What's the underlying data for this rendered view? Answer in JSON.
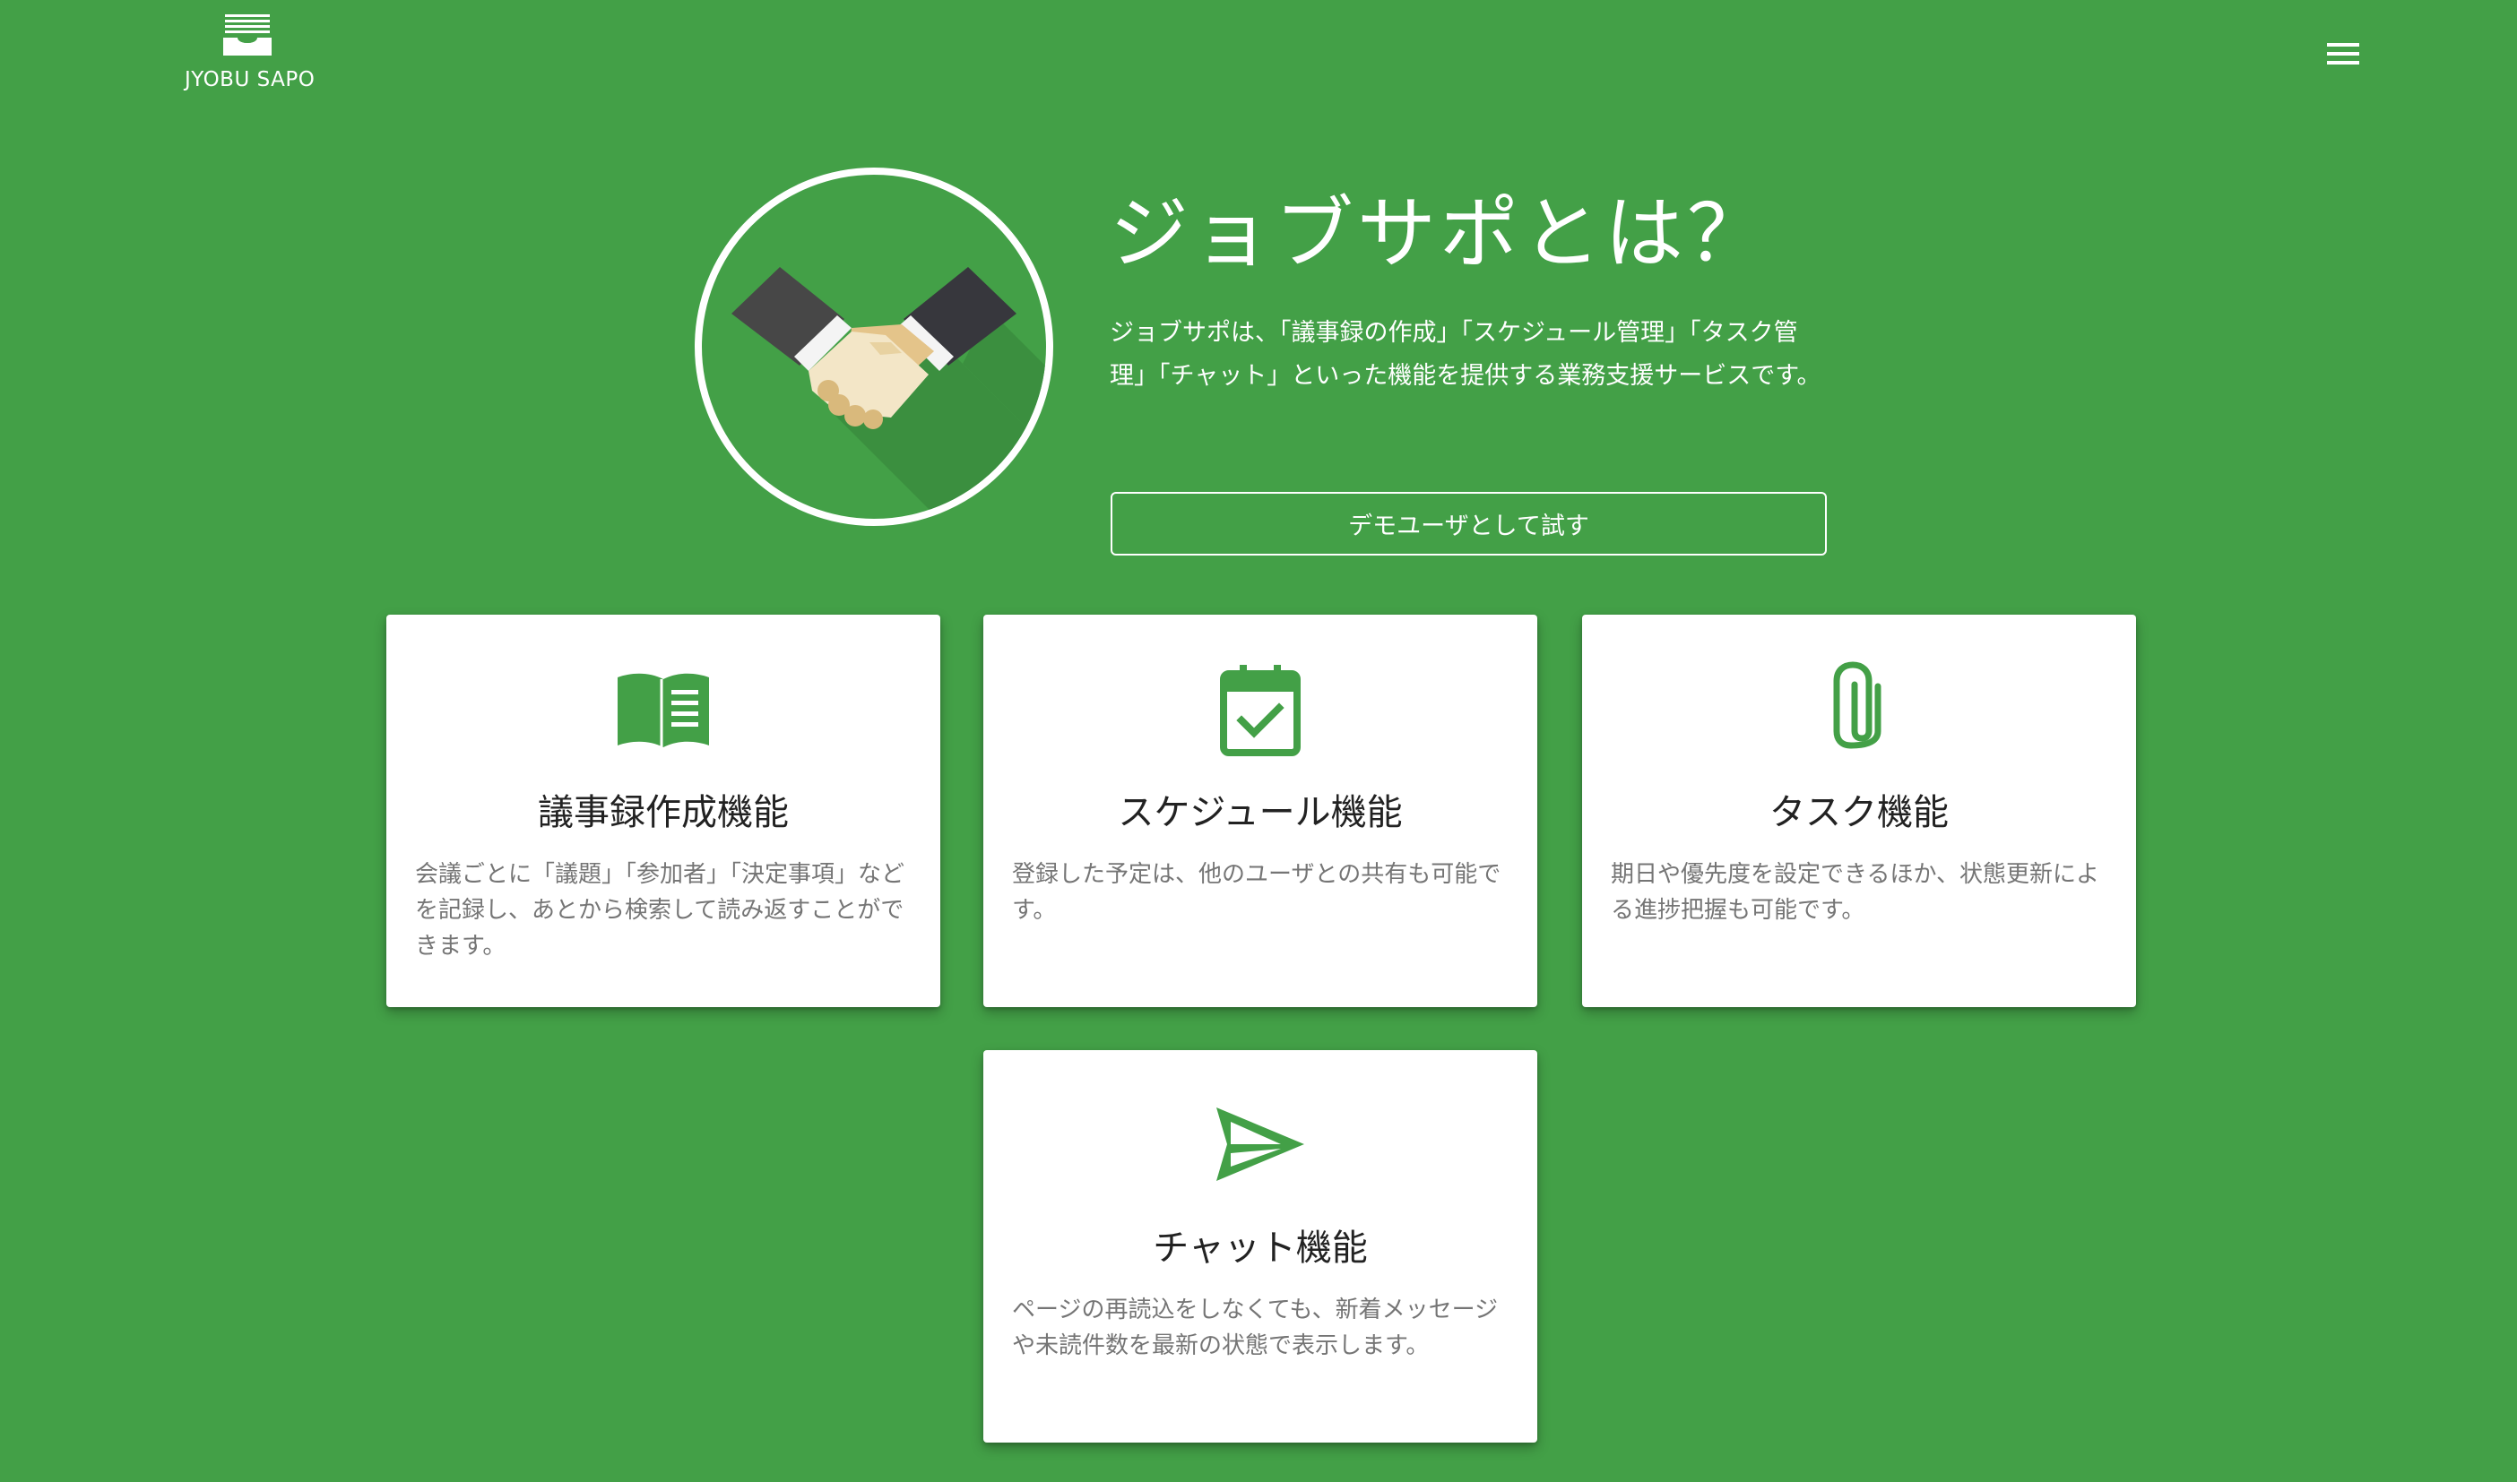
{
  "header": {
    "brand_name": "JYOBU SAPO",
    "brand_icon": "inbox-tray-icon",
    "menu_icon": "hamburger-menu-icon"
  },
  "hero": {
    "emblem_icon": "handshake-icon",
    "title": "ジョブサポとは？",
    "description": "ジョブサポは、「議事録の作成」「スケジュール管理」「タスク管理」「チャット」といった機能を提供する業務支援サービスです。",
    "demo_button_label": "デモユーザとして試す"
  },
  "features": [
    {
      "icon": "open-book-icon",
      "title": "議事録作成機能",
      "description": "会議ごとに「議題」「参加者」「決定事項」などを記録し、あとから検索して読み返すことができます。"
    },
    {
      "icon": "calendar-check-icon",
      "title": "スケジュール機能",
      "description": "登録した予定は、他のユーザとの共有も可能です。"
    },
    {
      "icon": "paperclip-icon",
      "title": "タスク機能",
      "description": "期日や優先度を設定できるほか、状態更新による進捗把握も可能です。"
    },
    {
      "icon": "send-icon",
      "title": "チャット機能",
      "description": "ページの再読込をしなくても、新着メッセージや未読件数を最新の状態で表示します。"
    }
  ],
  "colors": {
    "background": "#43a047",
    "accent": "#43a047",
    "card": "#ffffff",
    "card_text": "#757575",
    "card_title": "#222222"
  }
}
